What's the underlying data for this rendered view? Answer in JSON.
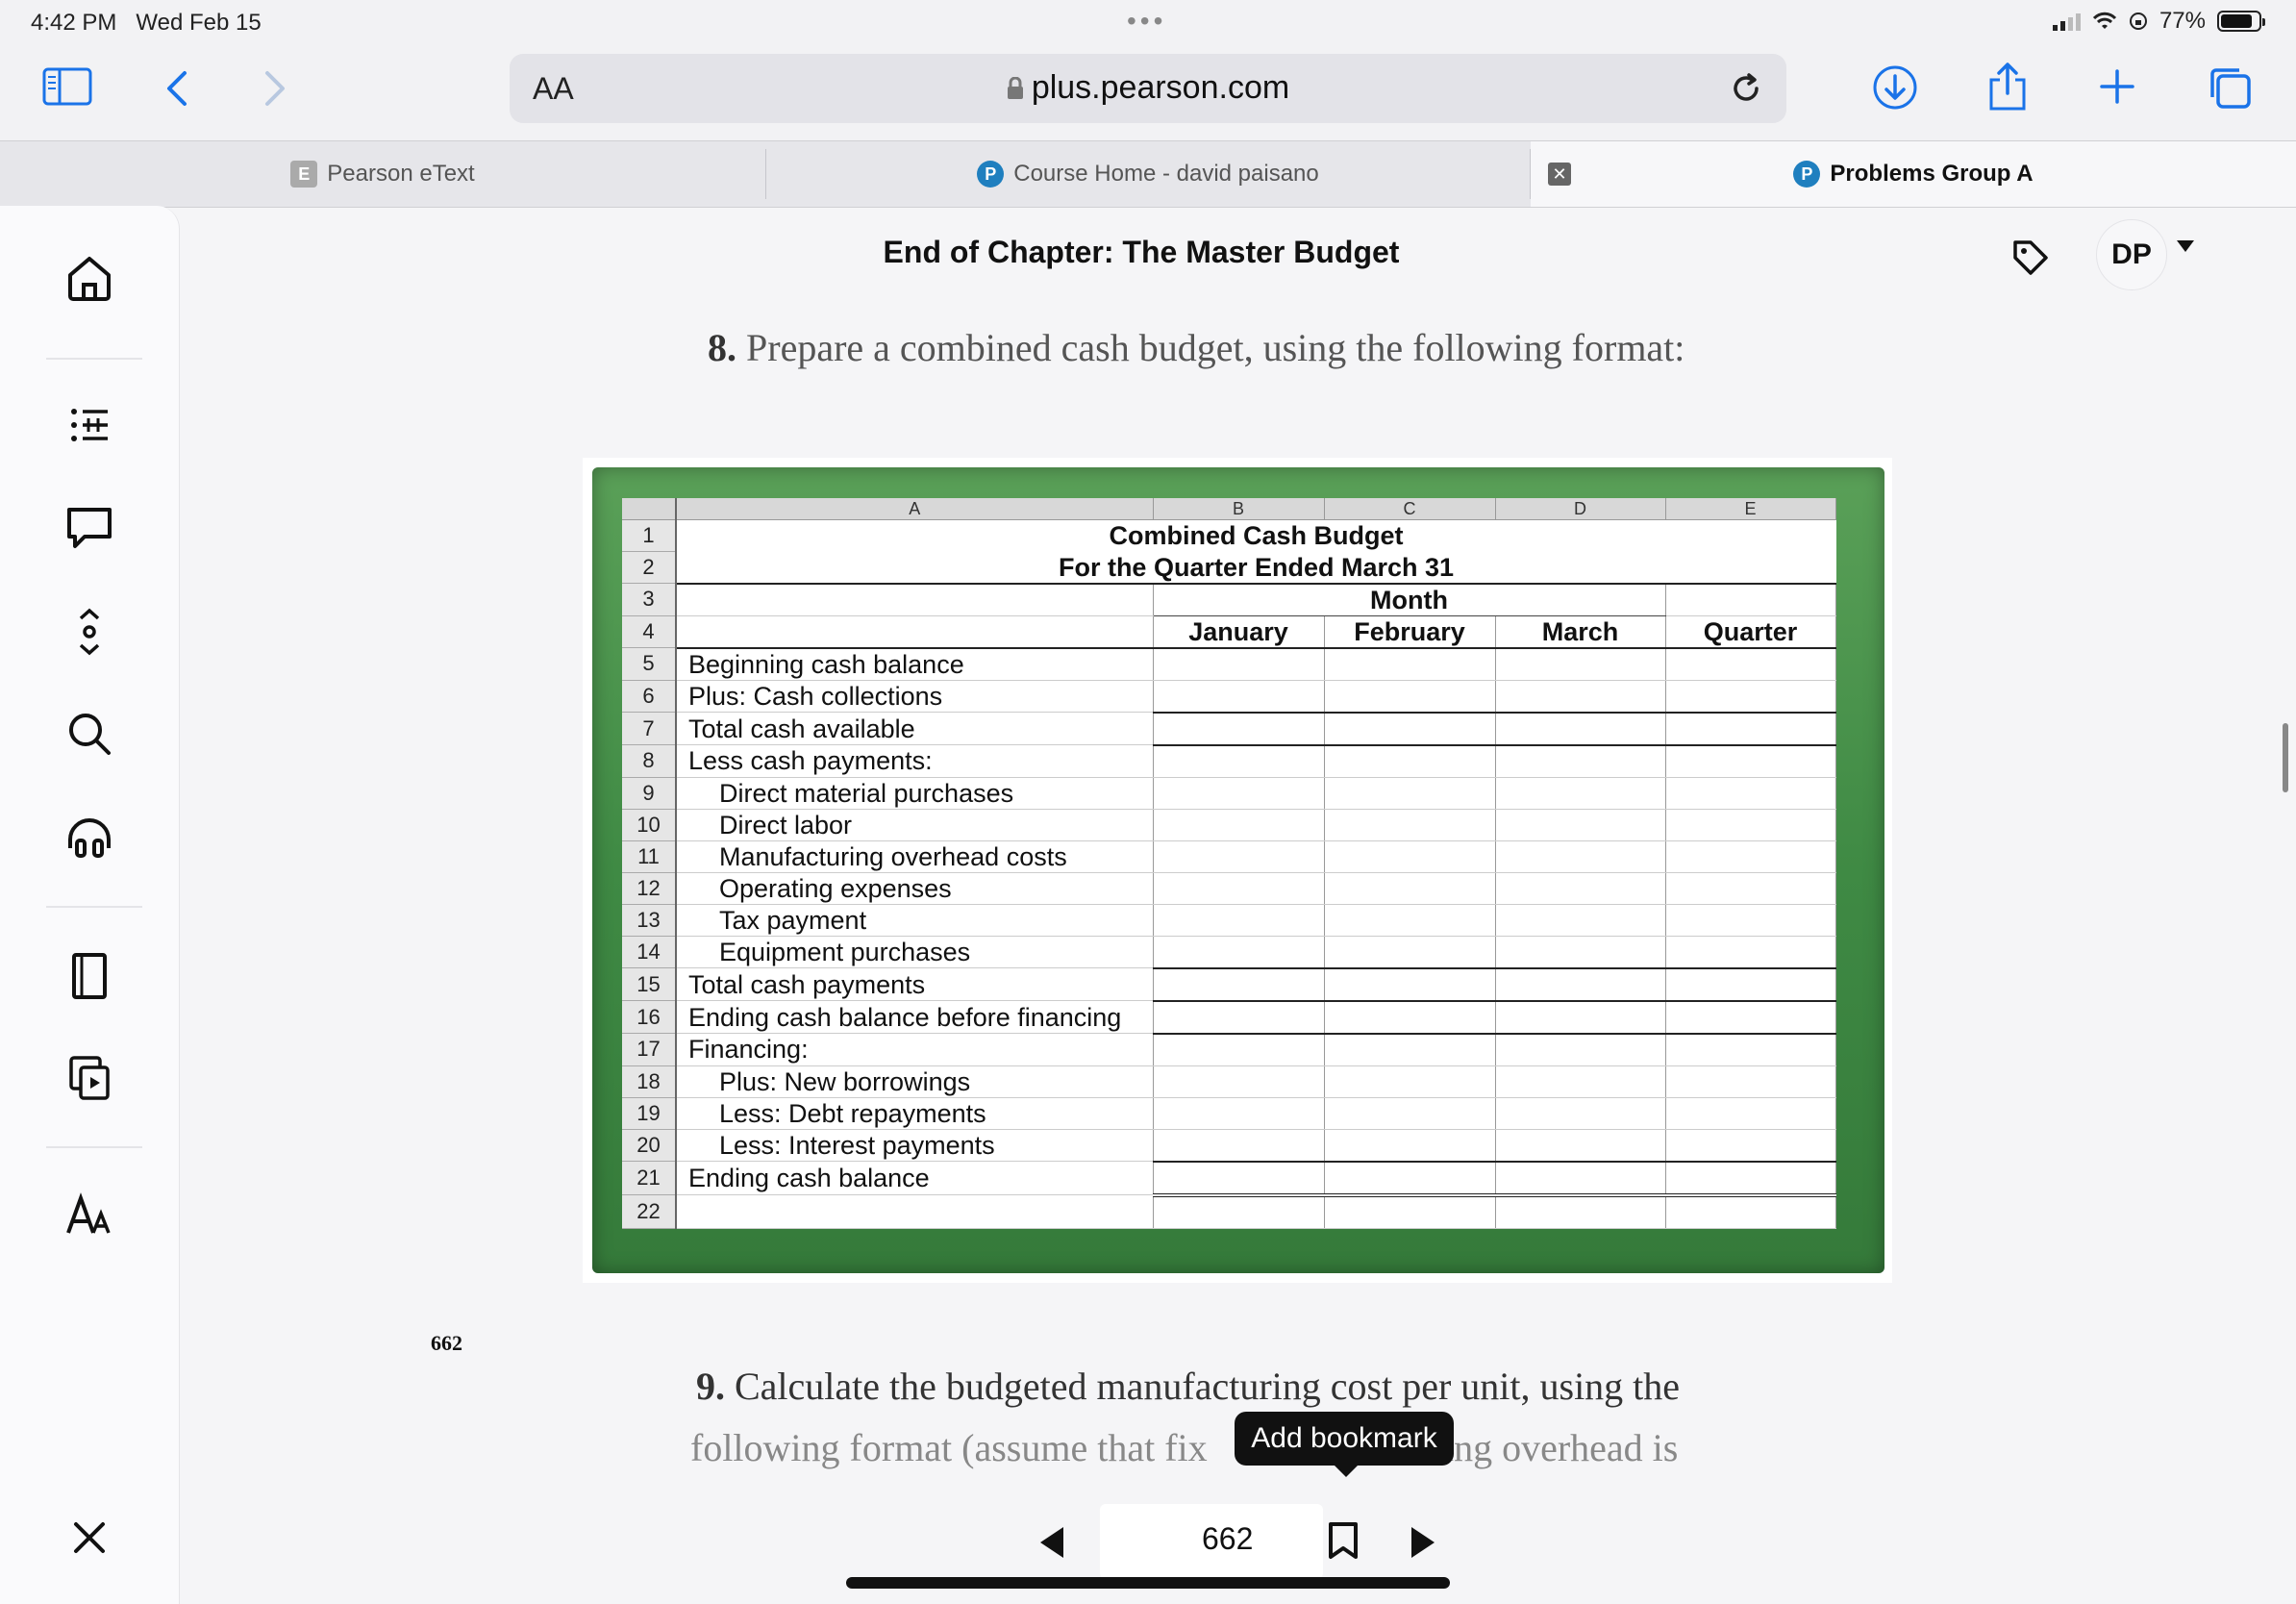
{
  "status_bar": {
    "time": "4:42 PM",
    "date": "Wed Feb 15",
    "battery": "77%"
  },
  "toolbar": {
    "aa_label": "AA",
    "url": "plus.pearson.com"
  },
  "tabs": [
    {
      "label": "Pearson eText",
      "favicon": "E"
    },
    {
      "label": "Course Home - david paisano",
      "favicon": "P"
    },
    {
      "label": "Problems Group A",
      "favicon": "P"
    }
  ],
  "header": {
    "title": "End of Chapter: The Master Budget",
    "avatar": "DP"
  },
  "content": {
    "q8_num": "8.",
    "q8_text": "Prepare a combined cash budget, using the following format:",
    "q9_num": "9.",
    "q9_text": "Calculate the budgeted manufacturing cost per unit, using the",
    "q9_text_2a": "following format (assume that fix",
    "q9_text_2b": "uring overhead is",
    "page_label": "662"
  },
  "spreadsheet": {
    "columns": [
      "A",
      "B",
      "C",
      "D",
      "E"
    ],
    "title": "Combined Cash Budget",
    "subtitle": "For the Quarter Ended March 31",
    "month_header": "Month",
    "month_cols": [
      "January",
      "February",
      "March",
      "Quarter"
    ],
    "row_numbers": [
      "1",
      "2",
      "3",
      "4",
      "5",
      "6",
      "7",
      "8",
      "9",
      "10",
      "11",
      "12",
      "13",
      "14",
      "15",
      "16",
      "17",
      "18",
      "19",
      "20",
      "21",
      "22"
    ],
    "rows": [
      "Beginning cash balance",
      "Plus: Cash collections",
      "Total cash available",
      "Less cash payments:",
      "Direct material purchases",
      "Direct labor",
      "Manufacturing overhead costs",
      "Operating expenses",
      "Tax payment",
      "Equipment purchases",
      "Total cash payments",
      "Ending cash balance before financing",
      "Financing:",
      "Plus: New borrowings",
      "Less: Debt repayments",
      "Less: Interest payments",
      "Ending cash balance"
    ]
  },
  "bottom_nav": {
    "page": "662",
    "tooltip": "Add bookmark"
  }
}
